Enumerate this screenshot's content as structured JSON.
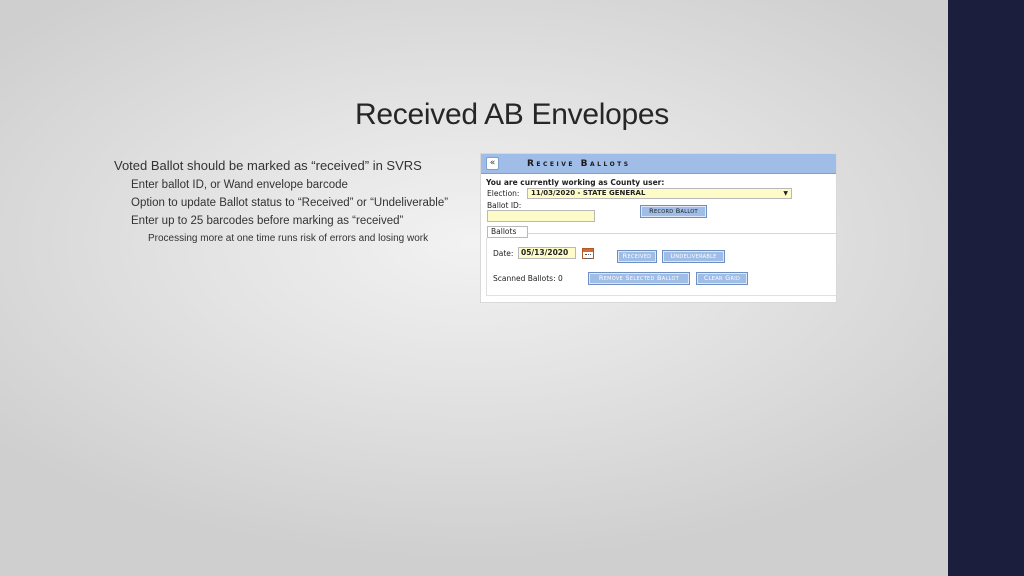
{
  "slide": {
    "title": "Received AB Envelopes",
    "bullets": {
      "main": "Voted Ballot should be marked as “received” in SVRS",
      "sub1": "Enter ballot ID, or Wand envelope barcode",
      "sub2": "Option to update Ballot status to “Received” or “Undeliverable”",
      "sub3": "Enter up to 25 barcodes before marking as “received”",
      "sub3a": "Processing more at one time runs risk of errors and losing work"
    }
  },
  "screenshot": {
    "collapse_icon": "«",
    "title": "Receive Ballots",
    "user_line": "You are currently working as County user:",
    "election_label": "Election:",
    "election_value": "11/03/2020 - STATE GENERAL",
    "dropdown_arrow": "▼",
    "ballot_id_label": "Ballot ID:",
    "ballot_id_value": "",
    "record_ballot_button": "Record Ballot",
    "tab_ballots": "Ballots",
    "date_label": "Date:",
    "date_value": "05/13/2020",
    "received_button": "Received",
    "undeliverable_button": "Undeliverable",
    "scanned_label": "Scanned Ballots: 0",
    "remove_button": "Remove Selected Ballot",
    "clear_button": "Clear Grid"
  },
  "colors": {
    "sidebar": "#1b1f3d",
    "header_blue": "#9fbde6",
    "input_yellow": "#fdfcc9"
  }
}
